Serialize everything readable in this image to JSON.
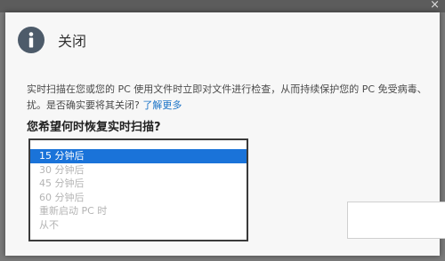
{
  "dialog": {
    "title": "关闭",
    "description_line1": "实时扫描在您或您的 PC 使用文件时立即对文件进行检查，从而持续保护您的 PC 免受病毒、",
    "description_line2": "扰。是否确实要将其关闭?",
    "learn_more": "了解更多",
    "question": "您希望何时恢复实时扫描?",
    "options": [
      "15 分钟后",
      "30 分钟后",
      "45 分钟后",
      "60 分钟后",
      "重新启动 PC 时",
      "从不"
    ],
    "selected_option": "15 分钟后",
    "icon": "info-icon"
  },
  "backdrop": {
    "close_glyph": "×"
  },
  "colors": {
    "selection": "#1a73d9",
    "link": "#1a73c7",
    "icon_bg": "#4d5b6a"
  }
}
